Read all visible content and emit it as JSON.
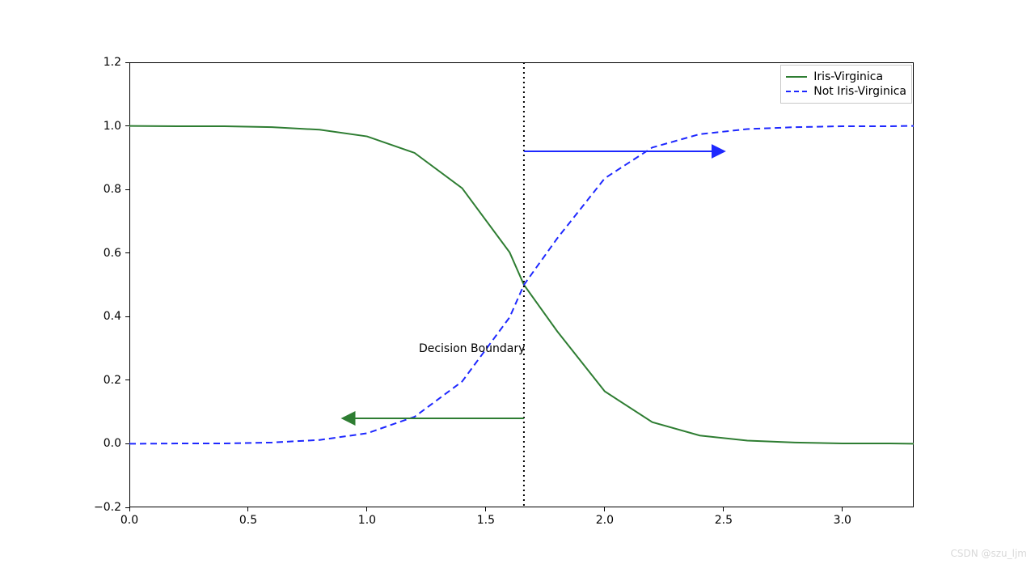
{
  "chart_data": {
    "type": "line",
    "title": "",
    "xlabel": "",
    "ylabel": "",
    "xlim": [
      0.0,
      3.3
    ],
    "ylim": [
      -0.2,
      1.2
    ],
    "xticks": [
      0.0,
      0.5,
      1.0,
      1.5,
      2.0,
      2.5,
      3.0
    ],
    "yticks": [
      -0.2,
      0.0,
      0.2,
      0.4,
      0.6,
      0.8,
      1.0,
      1.2
    ],
    "series": [
      {
        "name": "Iris-Virginica",
        "style": "solid",
        "color": "#2E7D32",
        "x": [
          0.0,
          0.2,
          0.4,
          0.6,
          0.8,
          1.0,
          1.2,
          1.4,
          1.6,
          1.66,
          1.8,
          2.0,
          2.2,
          2.4,
          2.6,
          2.8,
          3.0,
          3.2,
          3.3
        ],
        "y": [
          1.0,
          0.999,
          0.999,
          0.996,
          0.988,
          0.967,
          0.915,
          0.804,
          0.602,
          0.5,
          0.354,
          0.165,
          0.068,
          0.026,
          0.01,
          0.004,
          0.001,
          0.001,
          0.0
        ]
      },
      {
        "name": "Not Iris-Virginica",
        "style": "dashed",
        "color": "#1E28FF",
        "x": [
          0.0,
          0.2,
          0.4,
          0.6,
          0.8,
          1.0,
          1.2,
          1.4,
          1.6,
          1.66,
          1.8,
          2.0,
          2.2,
          2.4,
          2.6,
          2.8,
          3.0,
          3.2,
          3.3
        ],
        "y": [
          0.0,
          0.001,
          0.001,
          0.004,
          0.012,
          0.033,
          0.085,
          0.196,
          0.398,
          0.5,
          0.646,
          0.835,
          0.932,
          0.974,
          0.99,
          0.996,
          0.999,
          0.999,
          1.0
        ]
      }
    ],
    "decision_boundary_x": 1.66,
    "annotation": "Decision Boundary",
    "arrows": [
      {
        "name": "right",
        "x_from": 1.66,
        "x_to": 2.5,
        "y": 0.92,
        "color": "#1E28FF"
      },
      {
        "name": "left",
        "x_from": 1.66,
        "x_to": 0.9,
        "y": 0.08,
        "color": "#2E7D32"
      }
    ]
  },
  "legend": {
    "items": [
      {
        "label": "Iris-Virginica"
      },
      {
        "label": "Not Iris-Virginica"
      }
    ]
  },
  "xticklabels": [
    "0.0",
    "0.5",
    "1.0",
    "1.5",
    "2.0",
    "2.5",
    "3.0"
  ],
  "yticklabels": [
    "−0.2",
    "0.0",
    "0.2",
    "0.4",
    "0.6",
    "0.8",
    "1.0",
    "1.2"
  ],
  "watermark": "CSDN @szu_ljm"
}
